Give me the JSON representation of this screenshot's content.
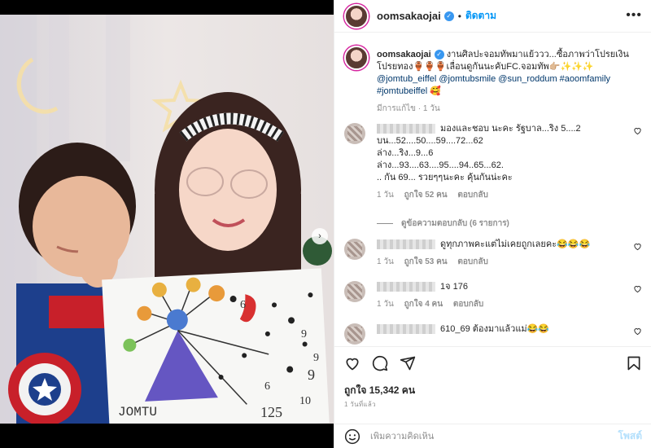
{
  "post": {
    "username": "oomsakaojai",
    "verified_mark": "✓",
    "separator": "•",
    "follow_label": "ติดตาม",
    "more_label": "•••"
  },
  "caption": {
    "username": "oomsakaojai",
    "text": " งานศิลปะจอมทัพมาแย้ววว...ซื้อภาพว่าโปรยเงิน โปรยทอง🏺🏺🏺เลื่อนดูกันนะคับFC.จอมทัพ👉🏼✨✨✨",
    "tags": "@jomtub_eiffel @jomtubsmile @sun_roddum #aoomfamily #jomtubeiffel 🥰",
    "meta": "มีการแก้ไข · 1 วัน"
  },
  "comments": [
    {
      "lines": [
        "มองและชอบ นะคะ รัฐบาล...ริง 5....2",
        "บน...52....50....59....72...62",
        "ล่าง...ริง...9...6",
        "ล่าง...93....63....95....94..65...62.",
        ".. กัน 69... รวยๆๆนะคะ คุ้นกันน่ะคะ"
      ],
      "time": "1 วัน",
      "likes": "ถูกใจ 52 คน",
      "reply": "ตอบกลับ"
    },
    {
      "lines": [
        "ดูทุกภาพคะแต่ไม่เคยถูกเลยคะ😂😂😂"
      ],
      "time": "1 วัน",
      "likes": "ถูกใจ 53 คน",
      "reply": "ตอบกลับ"
    },
    {
      "lines": [
        "1จ 176"
      ],
      "time": "1 วัน",
      "likes": "ถูกใจ 4 คน",
      "reply": "ตอบกลับ"
    },
    {
      "lines": [
        "610_69 ต้องมาแล้วแม่😂😂"
      ],
      "time": "",
      "likes": "",
      "reply": ""
    }
  ],
  "view_replies": "ดูข้อความตอบกลับ (6 รายการ)",
  "actions": {
    "likes": "ถูกใจ 15,342 คน",
    "time": "1 วันที่แล้ว"
  },
  "add_comment": {
    "placeholder": "เพิ่มความคิดเห็น",
    "post_label": "โพสต์"
  },
  "photo": {
    "drawing_text": "JOMTU",
    "drawing_number": "125",
    "drawing_digits": [
      "6",
      "9",
      "9",
      "6",
      "9",
      "10"
    ]
  }
}
